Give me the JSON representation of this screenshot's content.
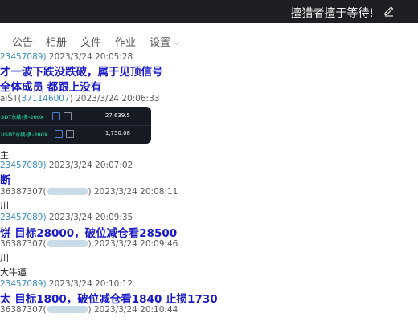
{
  "window": {
    "title": "擅猎者擅于等待!"
  },
  "tabs": [
    {
      "label": "公告"
    },
    {
      "label": "相册"
    },
    {
      "label": "文件"
    },
    {
      "label": "作业"
    },
    {
      "label": "设置"
    }
  ],
  "messages": [
    {
      "kind": "meta",
      "id": "23457089",
      "time": "2023/3/24 20:05:28"
    },
    {
      "kind": "big",
      "text": "才一波下跌没跌破，属于见顶信号"
    },
    {
      "kind": "big",
      "text": "全体成员  都跟上没有"
    },
    {
      "kind": "meta",
      "prefix": "ãiŜT",
      "id": "371146007",
      "time": "2023/3/24 20:06:33"
    },
    {
      "kind": "card"
    },
    {
      "kind": "text",
      "text": "主"
    },
    {
      "kind": "meta",
      "id": "23457089",
      "time": "2023/3/24 20:07:02"
    },
    {
      "kind": "big",
      "text": "断"
    },
    {
      "kind": "meta",
      "prefix": "36387307(",
      "time": "2023/3/24 20:08:11"
    },
    {
      "kind": "text",
      "text": "川"
    },
    {
      "kind": "meta",
      "id": "23457089",
      "time": "2023/3/24 20:09:35"
    },
    {
      "kind": "big2",
      "text": "饼   目标28000，破位减仓看28500"
    },
    {
      "kind": "meta",
      "prefix": "36387307(",
      "time": "2023/3/24 20:09:46"
    },
    {
      "kind": "text",
      "text": "川"
    },
    {
      "kind": "text",
      "text": "大牛逼"
    },
    {
      "kind": "meta",
      "id": "23457089",
      "time": "2023/3/24 20:10:12"
    },
    {
      "kind": "big2",
      "text": "太  目标1800，破位减仓看1840  止损1730"
    },
    {
      "kind": "meta",
      "prefix": "36387307(",
      "time": "2023/3/24 20:10:44"
    }
  ],
  "card": {
    "rows": [
      {
        "name": "SDT永续-多-200X",
        "value": "27,639.5"
      },
      {
        "name": "USDT永续-多-200X",
        "value": "1,750.08"
      }
    ]
  },
  "colors": {
    "titlebar": "#1e1f22",
    "accent_blue": "#1919c9",
    "uid_blue": "#3a8bbf",
    "card_bg": "#161a22",
    "card_green": "#1fb08a"
  },
  "icons": {
    "edit": "pencil-icon",
    "dropdown": "chevron-down-icon"
  }
}
